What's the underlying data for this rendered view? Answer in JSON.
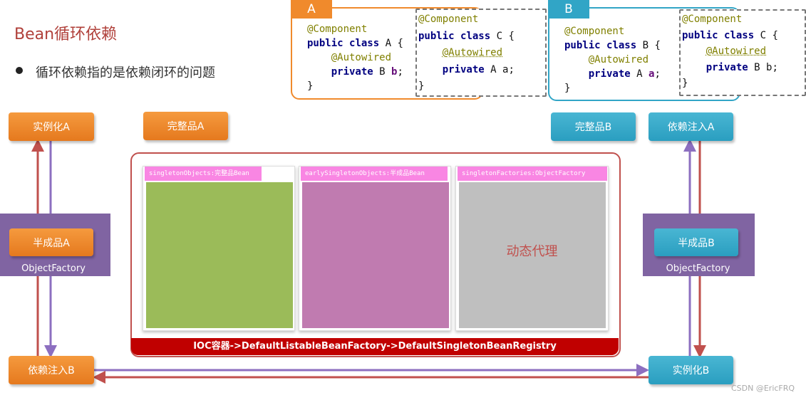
{
  "title": "Bean循环依赖",
  "bullet": "循环依赖指的是依赖闭环的问题",
  "code_a": {
    "tag": "A",
    "annotation": "@Component",
    "kw_public": "public",
    "kw_class": "class",
    "class_name": "A {",
    "autowired": "@Autowired",
    "kw_private": "private",
    "field_type": "B",
    "field_name": "b",
    "semicolon": ";",
    "close": "}"
  },
  "code_a_inner": {
    "annotation": "@Component",
    "kw_public": "public",
    "kw_class": "class",
    "class_name": "C {",
    "autowired": "@Autowired",
    "kw_private": "private",
    "field_type": "A",
    "field_name": "a;",
    "close": "}"
  },
  "code_b": {
    "tag": "B",
    "annotation": "@Component",
    "kw_public": "public",
    "kw_class": "class",
    "class_name": "B {",
    "autowired": "@Autowired",
    "kw_private": "private",
    "field_type": "A",
    "field_name": "a",
    "semicolon": ";",
    "close": "}"
  },
  "code_b_inner": {
    "annotation": "@Component",
    "kw_public": "public",
    "kw_class": "class",
    "class_name": "C {",
    "autowired": "@Autowired",
    "kw_private": "private",
    "field_type": "B",
    "field_name": "b;",
    "close": "}"
  },
  "left": {
    "instantiate": "实例化A",
    "half": "半成品A",
    "factory": "ObjectFactory",
    "inject": "依赖注入B"
  },
  "right": {
    "inject": "依赖注入A",
    "half": "半成品B",
    "factory": "ObjectFactory",
    "instantiate": "实例化B"
  },
  "complete_a": "完整品A",
  "complete_b": "完整品B",
  "columns": [
    {
      "head": "singletonObjects:完整品Bean",
      "body": "",
      "color": "#9bbb59"
    },
    {
      "head": "earlySingletonObjects:半成品Bean",
      "body": "",
      "color": "#c07bb0"
    },
    {
      "head": "singletonFactories:ObjectFactory",
      "body": "动态代理",
      "color": "#bfbfbf"
    }
  ],
  "ioc_bar": "IOC容器->DefaultListableBeanFactory->DefaultSingletonBeanRegistry",
  "watermark": "CSDN @EricFRQ",
  "colors": {
    "orange": "#f08a2c",
    "teal": "#31a5c6",
    "purple": "#8064a2",
    "red_arrow": "#c0504d",
    "purple_arrow": "#8c6fc0",
    "ioc_red": "#c00000"
  }
}
